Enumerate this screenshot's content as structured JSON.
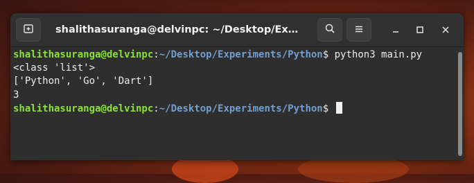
{
  "window": {
    "title": "shalithasuranga@delvinpc: ~/Desktop/Experimen..."
  },
  "icons": {
    "new_tab": "new-tab-icon",
    "search": "search-icon",
    "menu": "hamburger-menu-icon",
    "minimize": "minimize-icon",
    "maximize": "maximize-icon",
    "close": "close-icon"
  },
  "terminal": {
    "prompt_user": "shalithasuranga@delvinpc",
    "prompt_sep": ":",
    "prompt_path": "~/Desktop/Experiments/Python",
    "prompt_symbol": "$",
    "command": " python3 main.py",
    "output_lines": [
      "<class 'list'>",
      "['Python', 'Go', 'Dart']",
      "3"
    ],
    "colors": {
      "user": "#8ae234",
      "path": "#729fcf",
      "text": "#ededed",
      "background": "#2e2e2e"
    }
  }
}
